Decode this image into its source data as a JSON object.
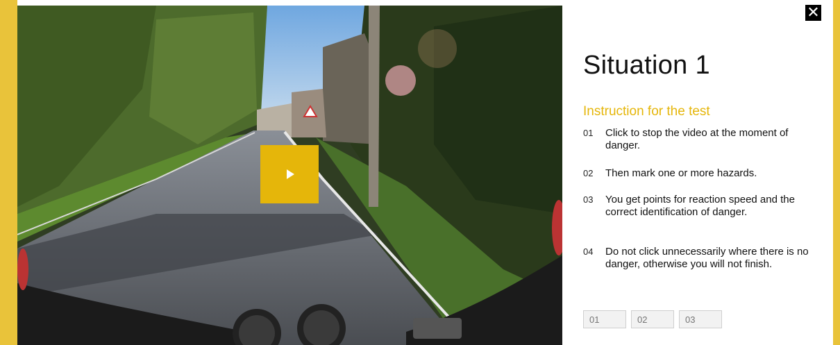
{
  "video": {
    "play_icon": "play-icon",
    "accent": "#e5b60a"
  },
  "close": {
    "icon": "close-icon",
    "glyph": "✕"
  },
  "panel": {
    "title": "Situation 1",
    "subtitle": "Instruction for the test",
    "steps": [
      {
        "num": "01",
        "text": "Click to stop the video at the moment of danger."
      },
      {
        "num": "02",
        "text": "Then mark one or more hazards."
      },
      {
        "num": "03",
        "text": "You get points for reaction speed and the correct identification of danger."
      },
      {
        "num": "04",
        "text": "Do not click unnecessarily where there is no danger, otherwise you will not finish."
      }
    ],
    "answers": [
      {
        "placeholder": "01"
      },
      {
        "placeholder": "02"
      },
      {
        "placeholder": "03"
      }
    ]
  },
  "colors": {
    "frame": "#e9c33a",
    "accent": "#e5b60a",
    "text": "#111111"
  }
}
